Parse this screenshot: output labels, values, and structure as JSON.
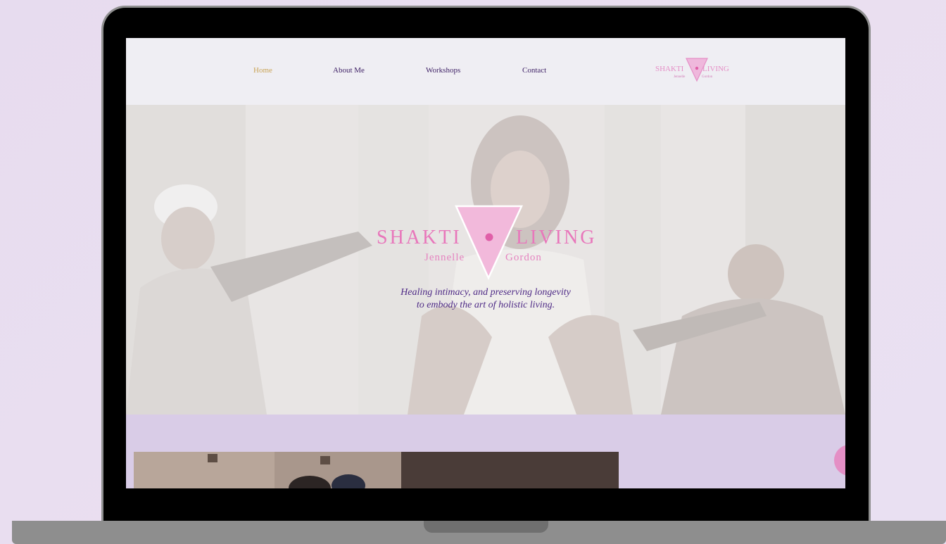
{
  "nav": {
    "items": [
      {
        "label": "Home",
        "active": true
      },
      {
        "label": "About Me",
        "active": false
      },
      {
        "label": "Workshops",
        "active": false
      },
      {
        "label": "Contact",
        "active": false
      }
    ],
    "logo": {
      "word1": "SHAKTI",
      "word2": "LIVING",
      "first": "Jennelle",
      "last": "Gordon"
    }
  },
  "hero": {
    "logo": {
      "word1": "SHAKTI",
      "word2": "LIVING",
      "first": "Jennelle",
      "last": "Gordon"
    },
    "tagline_line1": "Healing intimacy, and preserving longevity",
    "tagline_line2": "to embody the art of holistic living."
  },
  "colors": {
    "accent_pink": "#e05fa8",
    "logo_pink": "#e58fc6",
    "tagline_purple": "#4e2a86",
    "active_gold": "#c9a355",
    "lower_lavender": "#d9cce7"
  },
  "icons": {
    "chat": "chat-bubble-icon"
  }
}
